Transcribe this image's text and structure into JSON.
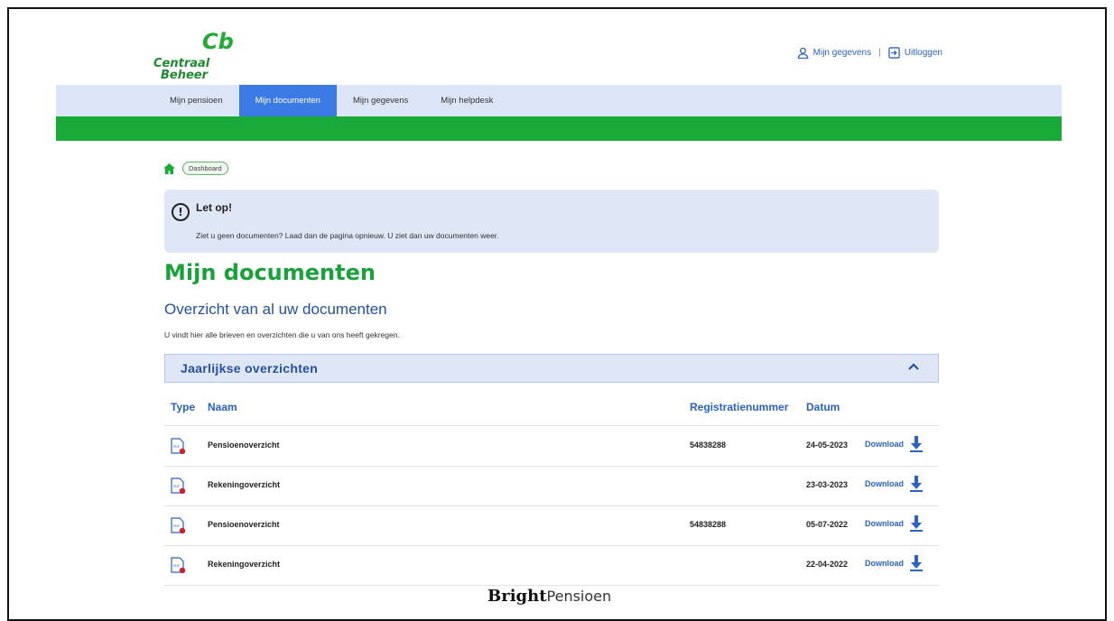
{
  "logo": {
    "mark": "Cb",
    "line1": "Centraal",
    "line2": "Beheer"
  },
  "header": {
    "account_label": "Mijn gegevens",
    "separator": "|",
    "logout_label": "Uitloggen"
  },
  "nav": {
    "tabs": [
      {
        "label": "Mijn pensioen",
        "active": false
      },
      {
        "label": "Mijn documenten",
        "active": true
      },
      {
        "label": "Mijn gegevens",
        "active": false
      },
      {
        "label": "Mijn helpdesk",
        "active": false
      }
    ]
  },
  "breadcrumb": {
    "item": "Dashboard"
  },
  "alert": {
    "title": "Let op!",
    "message": "Ziet u geen documenten? Laad dan de pagina opnieuw. U ziet dan uw documenten weer."
  },
  "page": {
    "title": "Mijn documenten",
    "subtitle": "Overzicht van al uw documenten",
    "intro": "U vindt hier alle brieven en overzichten die u van ons heeft gekregen."
  },
  "section": {
    "title": "Jaarlijkse overzichten",
    "expanded": true
  },
  "table": {
    "headers": {
      "type": "Type",
      "naam": "Naam",
      "registratie": "Registratienummer",
      "datum": "Datum"
    },
    "rows": [
      {
        "type": "PDF",
        "naam": "Pensioenoverzicht",
        "registratie": "54838288",
        "datum": "24-05-2023",
        "download": "Download"
      },
      {
        "type": "PDF",
        "naam": "Rekeningoverzicht",
        "registratie": "",
        "datum": "23-03-2023",
        "download": "Download"
      },
      {
        "type": "PDF",
        "naam": "Pensioenoverzicht",
        "registratie": "54838288",
        "datum": "05-07-2022",
        "download": "Download"
      },
      {
        "type": "PDF",
        "naam": "Rekeningoverzicht",
        "registratie": "",
        "datum": "22-04-2022",
        "download": "Download"
      }
    ]
  },
  "footer": {
    "brand_bold": "Bright",
    "brand_rest": "Pensioen"
  },
  "colors": {
    "green": "#1aaa3a",
    "blue": "#2a62c9",
    "nav_bg": "#dde6f8",
    "active_tab": "#3c7be6",
    "panel": "#dfe6f5",
    "pdf_dot": "#d0202a"
  }
}
